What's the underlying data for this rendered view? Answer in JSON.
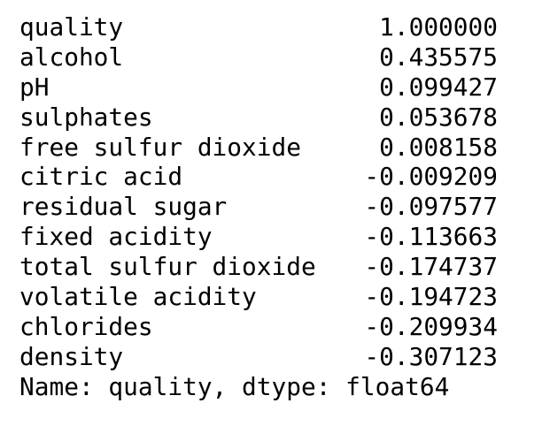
{
  "series_output": {
    "rows": [
      {
        "label": "quality",
        "value": "1.000000"
      },
      {
        "label": "alcohol",
        "value": "0.435575"
      },
      {
        "label": "pH",
        "value": "0.099427"
      },
      {
        "label": "sulphates",
        "value": "0.053678"
      },
      {
        "label": "free sulfur dioxide",
        "value": "0.008158"
      },
      {
        "label": "citric acid",
        "value": "-0.009209"
      },
      {
        "label": "residual sugar",
        "value": "-0.097577"
      },
      {
        "label": "fixed acidity",
        "value": "-0.113663"
      },
      {
        "label": "total sulfur dioxide",
        "value": "-0.174737"
      },
      {
        "label": "volatile acidity",
        "value": "-0.194723"
      },
      {
        "label": "chlorides",
        "value": "-0.209934"
      },
      {
        "label": "density",
        "value": "-0.307123"
      }
    ],
    "footer": "Name: quality, dtype: float64"
  }
}
